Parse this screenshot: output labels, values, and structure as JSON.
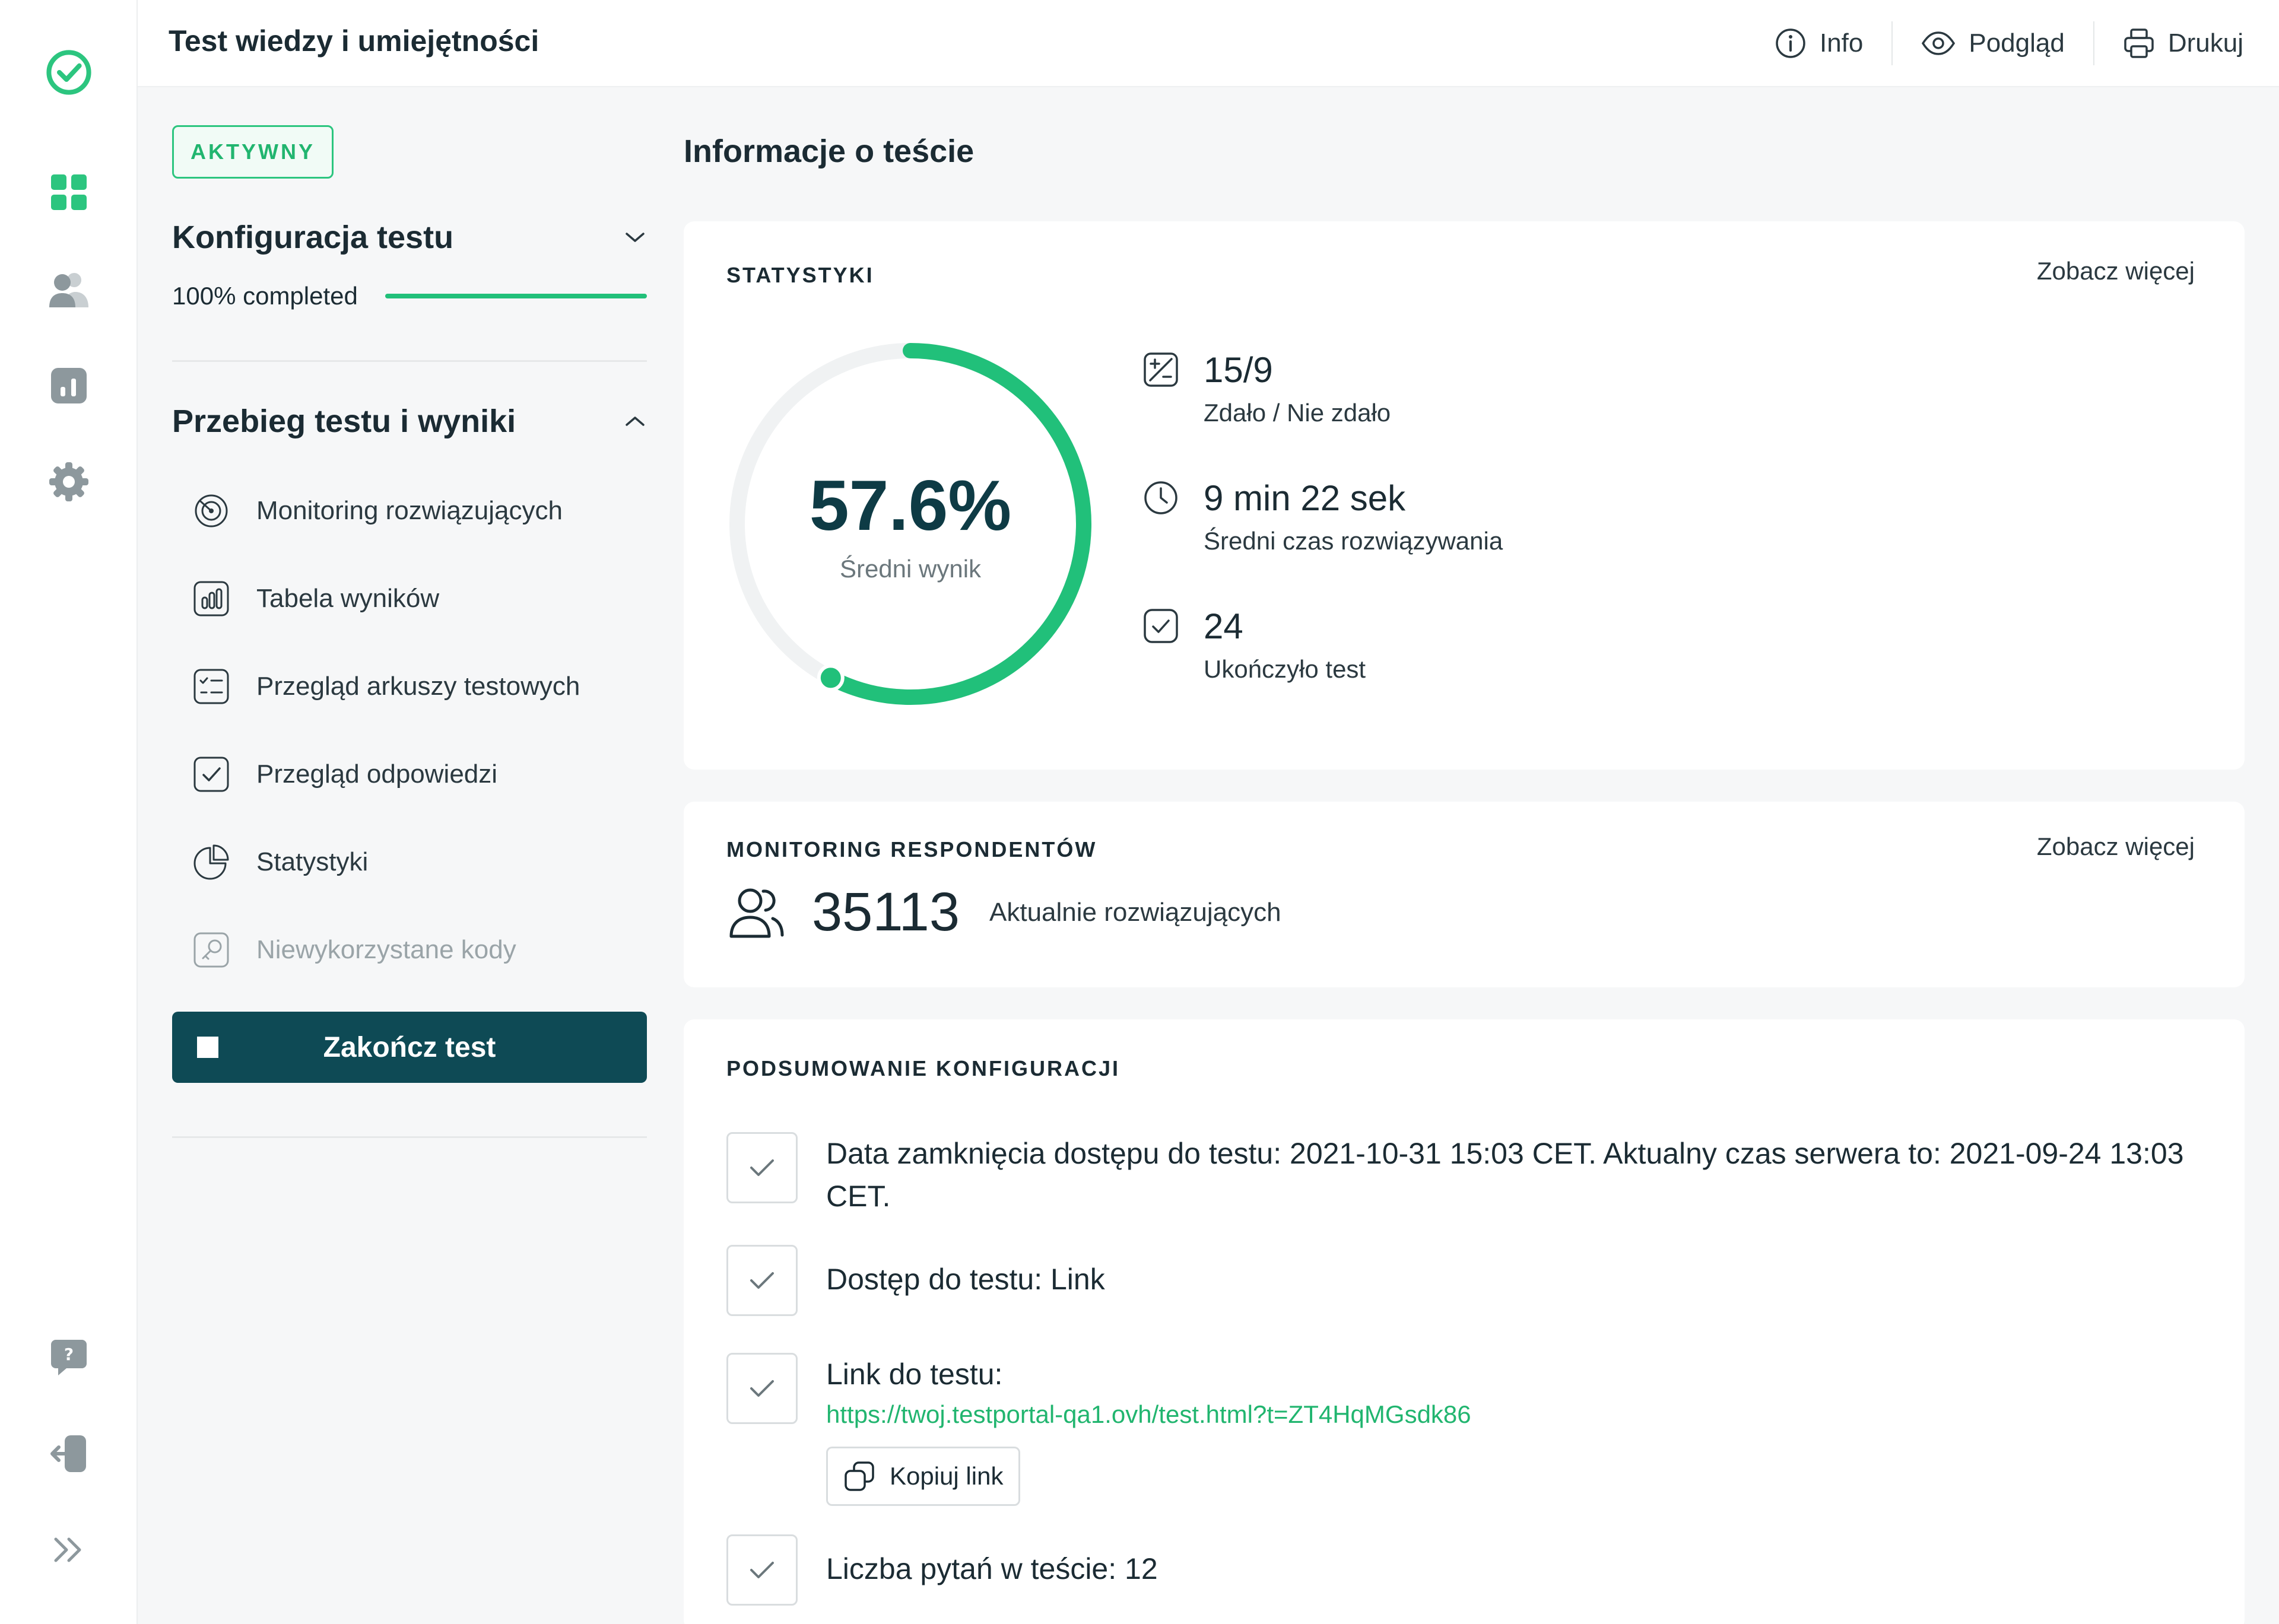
{
  "header": {
    "title": "Test wiedzy i umiejętności",
    "actions": [
      {
        "label": "Info",
        "icon": "info-icon"
      },
      {
        "label": "Podgląd",
        "icon": "eye-icon"
      },
      {
        "label": "Drukuj",
        "icon": "printer-icon"
      }
    ]
  },
  "rail": {
    "top_icons": [
      "logo-check-icon",
      "dashboard-icon",
      "users-icon",
      "reports-icon",
      "settings-icon"
    ],
    "bottom_icons": [
      "help-icon",
      "logout-icon",
      "expand-icon"
    ]
  },
  "sidebar": {
    "status_badge": "AKTYWNY",
    "config_section": {
      "title": "Konfiguracja testu",
      "progress_label": "100% completed",
      "progress_fraction": 1.0
    },
    "run_section": {
      "title": "Przebieg testu i wyniki",
      "items": [
        {
          "label": "Monitoring rozwiązujących",
          "icon": "monitoring-icon",
          "enabled": true
        },
        {
          "label": "Tabela wyników",
          "icon": "results-table-icon",
          "enabled": true
        },
        {
          "label": "Przegląd arkuszy testowych",
          "icon": "sheets-icon",
          "enabled": true
        },
        {
          "label": "Przegląd odpowiedzi",
          "icon": "answers-icon",
          "enabled": true
        },
        {
          "label": "Statystyki",
          "icon": "pie-chart-icon",
          "enabled": true
        },
        {
          "label": "Niewykorzystane kody",
          "icon": "key-icon",
          "enabled": false
        }
      ]
    },
    "end_button": "Zakończ test"
  },
  "main": {
    "title": "Informacje o teście",
    "stats_card": {
      "label": "STATYSTYKI",
      "more": "Zobacz więcej",
      "average_score": "57.6%",
      "average_score_fraction": 0.576,
      "average_label": "Średni wynik",
      "items": [
        {
          "value": "15/9",
          "desc": "Zdało / Nie zdało",
          "icon": "pass-fail-icon"
        },
        {
          "value": "9 min 22 sek",
          "desc": "Średni czas rozwiązywania",
          "icon": "clock-icon"
        },
        {
          "value": "24",
          "desc": "Ukończyło test",
          "icon": "check-square-icon"
        }
      ]
    },
    "monitoring_card": {
      "label": "MONITORING RESPONDENTÓW",
      "more": "Zobacz więcej",
      "count": "35113",
      "desc": "Aktualnie rozwiązujących"
    },
    "summary_card": {
      "label": "PODSUMOWANIE KONFIGURACJI",
      "items": [
        {
          "text": "Data zamknięcia dostępu do testu: 2021-10-31 15:03 CET. Aktualny czas serwera to: 2021-09-24 13:03 CET."
        },
        {
          "text": "Dostęp do testu: Link"
        },
        {
          "text": "Link do testu:",
          "link": "https://twoj.testportal-qa1.ovh/test.html?t=ZT4HqMGsdk86",
          "copy_label": "Kopiuj link"
        },
        {
          "text": "Liczba pytań w teście: 12"
        }
      ]
    }
  },
  "colors": {
    "accent": "#21c07a",
    "dark_teal": "#0e4a55",
    "track": "#f0f2f3"
  }
}
